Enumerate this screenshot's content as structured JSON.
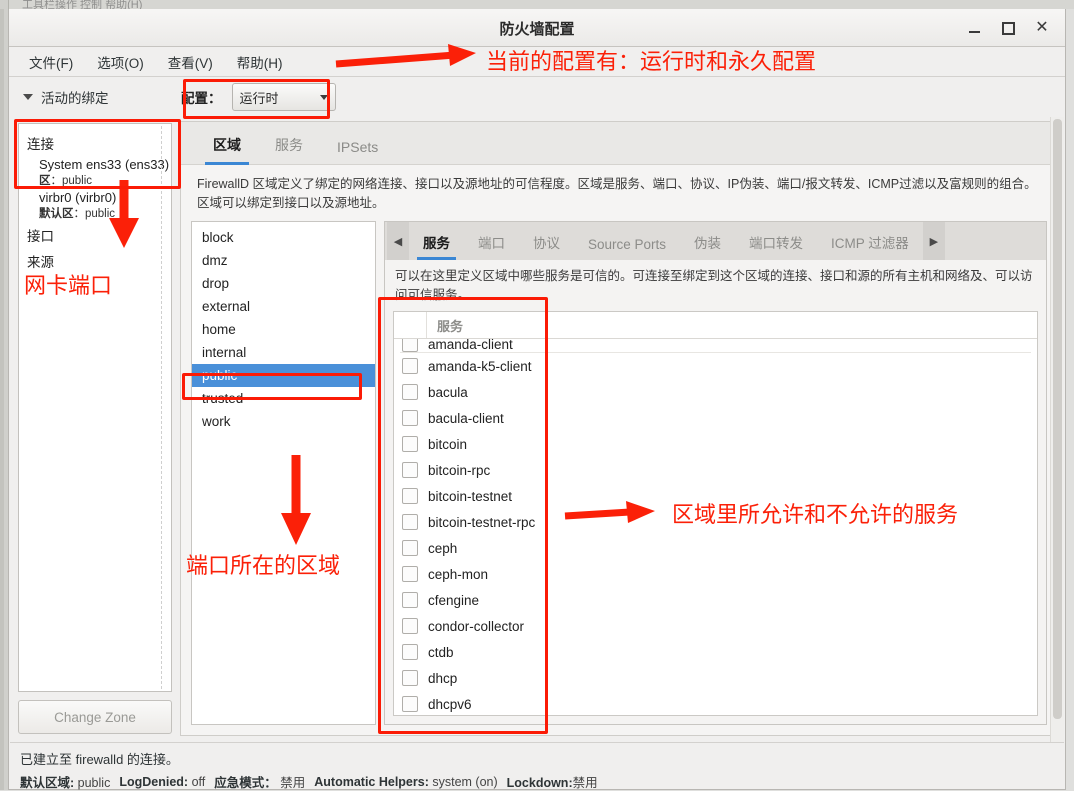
{
  "background_window": {
    "menu_strip": "工具栏操作    控制    帮助(H)"
  },
  "window": {
    "title": "防火墙配置",
    "controls": {
      "minimize": "minimize-icon",
      "maximize": "maximize-icon",
      "close": "close-icon"
    }
  },
  "menubar": {
    "items": [
      "文件(F)",
      "选项(O)",
      "查看(V)",
      "帮助(H)"
    ]
  },
  "toolbar": {
    "active_bindings_label": "活动的绑定",
    "config_label": "配置：",
    "config_value": "运行时"
  },
  "bindings": {
    "groups": [
      {
        "title": "连接",
        "children": [
          {
            "name": "System ens33 (ens33)",
            "zone_label": "区",
            "zone_sep": "：",
            "zone": "public"
          },
          {
            "name": "virbr0 (virbr0)",
            "zone_label": "默认区",
            "zone_sep": "：",
            "zone": "public"
          }
        ]
      },
      {
        "title": "接口",
        "children": []
      },
      {
        "title": "来源",
        "children": []
      }
    ],
    "change_zone_button": "Change Zone"
  },
  "main_tabs": [
    {
      "label": "区域",
      "active": true
    },
    {
      "label": "服务",
      "active": false
    },
    {
      "label": "IPSets",
      "active": false
    }
  ],
  "zone_description": "FirewallD 区域定义了绑定的网络连接、接口以及源地址的可信程度。区域是服务、端口、协议、IP伪装、端口/报文转发、ICMP过滤以及富规则的组合。区域可以绑定到接口以及源地址。",
  "zones": {
    "items": [
      "block",
      "dmz",
      "drop",
      "external",
      "home",
      "internal",
      "public",
      "trusted",
      "work"
    ],
    "selected": "public"
  },
  "sub_tabs": {
    "prev_arrow": "chevron-left-icon",
    "next_arrow": "chevron-right-icon",
    "items": [
      {
        "label": "服务",
        "active": true
      },
      {
        "label": "端口",
        "active": false
      },
      {
        "label": "协议",
        "active": false
      },
      {
        "label": "Source Ports",
        "active": false
      },
      {
        "label": "伪装",
        "active": false
      },
      {
        "label": "端口转发",
        "active": false
      },
      {
        "label": "ICMP 过滤器",
        "active": false
      }
    ]
  },
  "services_description": "可以在这里定义区域中哪些服务是可信的。可连接至绑定到这个区域的连接、接口和源的所有主机和网络及、可以访问可信服务。",
  "services": {
    "column_header": "服务",
    "rows": [
      {
        "name": "amanda-client",
        "checked": false,
        "clipped": true
      },
      {
        "name": "amanda-k5-client",
        "checked": false
      },
      {
        "name": "bacula",
        "checked": false
      },
      {
        "name": "bacula-client",
        "checked": false
      },
      {
        "name": "bitcoin",
        "checked": false
      },
      {
        "name": "bitcoin-rpc",
        "checked": false
      },
      {
        "name": "bitcoin-testnet",
        "checked": false
      },
      {
        "name": "bitcoin-testnet-rpc",
        "checked": false
      },
      {
        "name": "ceph",
        "checked": false
      },
      {
        "name": "ceph-mon",
        "checked": false
      },
      {
        "name": "cfengine",
        "checked": false
      },
      {
        "name": "condor-collector",
        "checked": false
      },
      {
        "name": "ctdb",
        "checked": false
      },
      {
        "name": "dhcp",
        "checked": false
      },
      {
        "name": "dhcpv6",
        "checked": false
      }
    ]
  },
  "statusbar": {
    "connection": "已建立至 firewalld 的连接。",
    "default_zone_key": "默认区域:",
    "default_zone_value": "public",
    "logdenied_key": "LogDenied:",
    "logdenied_value": "off",
    "panic_key": "应急模式：",
    "panic_value": "禁用",
    "helpers_key": "Automatic Helpers:",
    "helpers_value": "system (on)",
    "lockdown_key": "Lockdown:",
    "lockdown_value": "禁用"
  },
  "annotations": {
    "color": "#fb2008",
    "config_note": "当前的配置有：运行时和永久配置",
    "nic_note": "网卡端口",
    "zone_note": "端口所在的区域",
    "services_note": "区域里所允许和不允许的服务"
  }
}
